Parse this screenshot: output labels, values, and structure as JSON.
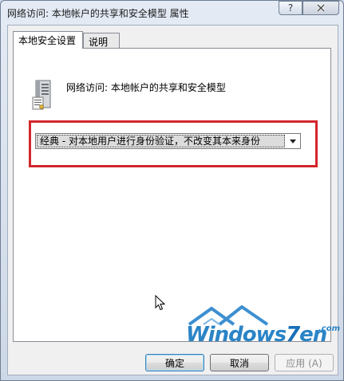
{
  "window": {
    "title": "网络访问: 本地帐户的共享和安全模型 属性",
    "help_label": "?",
    "close_icon": "close-icon"
  },
  "tabs": [
    {
      "label": "本地安全设置",
      "active": true
    },
    {
      "label": "说明",
      "active": false
    }
  ],
  "policy": {
    "icon": "server-icon",
    "label": "网络访问: 本地帐户的共享和安全模型"
  },
  "dropdown": {
    "selected": "经典 - 对本地用户进行身份验证，不改变其本来身份",
    "arrow_icon": "chevron-down-icon",
    "highlight_color": "#d3262b"
  },
  "watermark": {
    "prefix": "Windows",
    "digit": "7",
    "suffix": "en",
    "domain": ".com"
  },
  "buttons": {
    "ok": "确定",
    "cancel": "取消",
    "apply": "应用 (A)"
  }
}
